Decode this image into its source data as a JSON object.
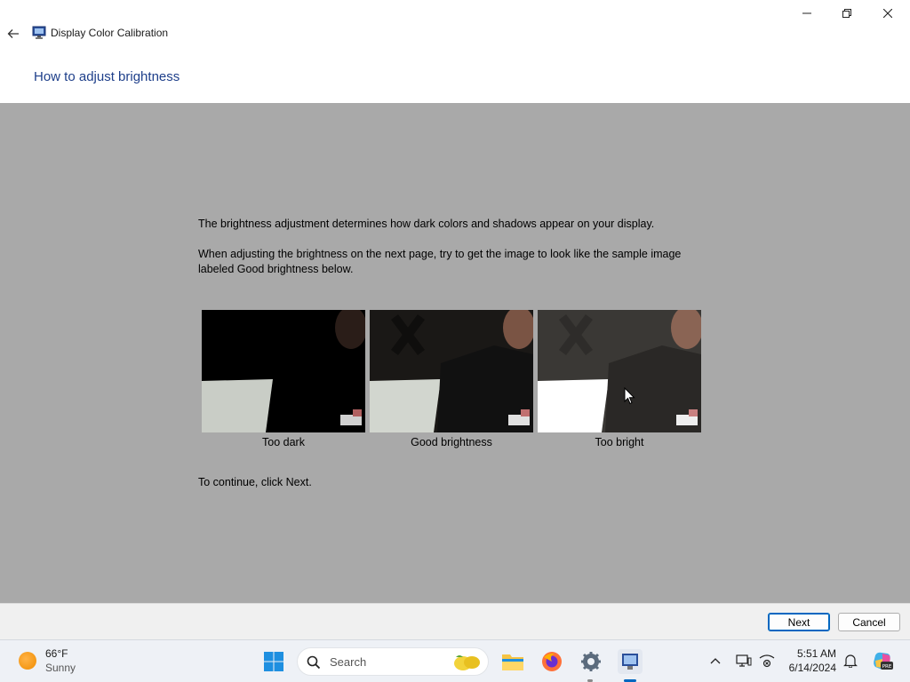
{
  "window": {
    "title": "Display Color Calibration",
    "heading": "How to adjust brightness"
  },
  "content": {
    "paragraph1": "The brightness adjustment determines how dark colors and shadows appear on your display.",
    "paragraph2": "When adjusting the brightness on the next page, try to get the image to look like the sample image labeled Good brightness below.",
    "samples": [
      {
        "label": "Too dark"
      },
      {
        "label": "Good brightness"
      },
      {
        "label": "Too bright"
      }
    ],
    "continue_text": "To continue, click Next."
  },
  "footer": {
    "next_label": "Next",
    "cancel_label": "Cancel"
  },
  "taskbar": {
    "weather_temp": "66°F",
    "weather_desc": "Sunny",
    "search_placeholder": "Search",
    "time": "5:51 AM",
    "date": "6/14/2024"
  },
  "colors": {
    "heading": "#1e3f8a",
    "content_bg": "#a9a9a9",
    "accent": "#0067c0"
  }
}
